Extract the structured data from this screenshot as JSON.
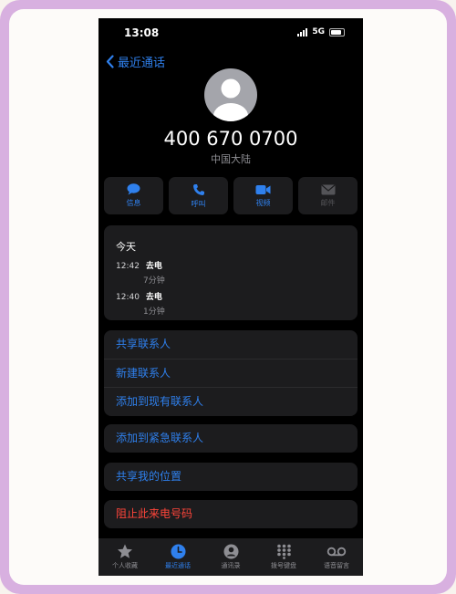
{
  "status_bar": {
    "time": "13:08",
    "network": "5G"
  },
  "nav": {
    "back_label": "最近通话"
  },
  "contact": {
    "number": "400 670 0700",
    "region": "中国大陆"
  },
  "actions": [
    {
      "label": "信息",
      "icon": "message-icon",
      "enabled": true
    },
    {
      "label": "呼叫",
      "icon": "phone-icon",
      "enabled": true
    },
    {
      "label": "视频",
      "icon": "video-icon",
      "enabled": true
    },
    {
      "label": "邮件",
      "icon": "mail-icon",
      "enabled": false
    }
  ],
  "history": {
    "day": "今天",
    "calls": [
      {
        "time": "12:42",
        "type": "去电",
        "duration": "7分钟"
      },
      {
        "time": "12:40",
        "type": "去电",
        "duration": "1分钟"
      }
    ]
  },
  "options_group_1": [
    "共享联系人",
    "新建联系人",
    "添加到现有联系人"
  ],
  "options_group_2": [
    "添加到紧急联系人"
  ],
  "options_group_3": [
    "共享我的位置"
  ],
  "options_group_4": [
    "阻止此来电号码"
  ],
  "tabs": [
    {
      "label": "个人收藏",
      "icon": "star-icon",
      "active": false
    },
    {
      "label": "最近通话",
      "icon": "clock-icon",
      "active": true
    },
    {
      "label": "通讯录",
      "icon": "contact-icon",
      "active": false
    },
    {
      "label": "拨号键盘",
      "icon": "keypad-icon",
      "active": false
    },
    {
      "label": "语音留言",
      "icon": "voicemail-icon",
      "active": false
    }
  ],
  "colors": {
    "accent": "#2f80ed",
    "danger": "#ff453a",
    "frame": "#d8b0e0"
  }
}
